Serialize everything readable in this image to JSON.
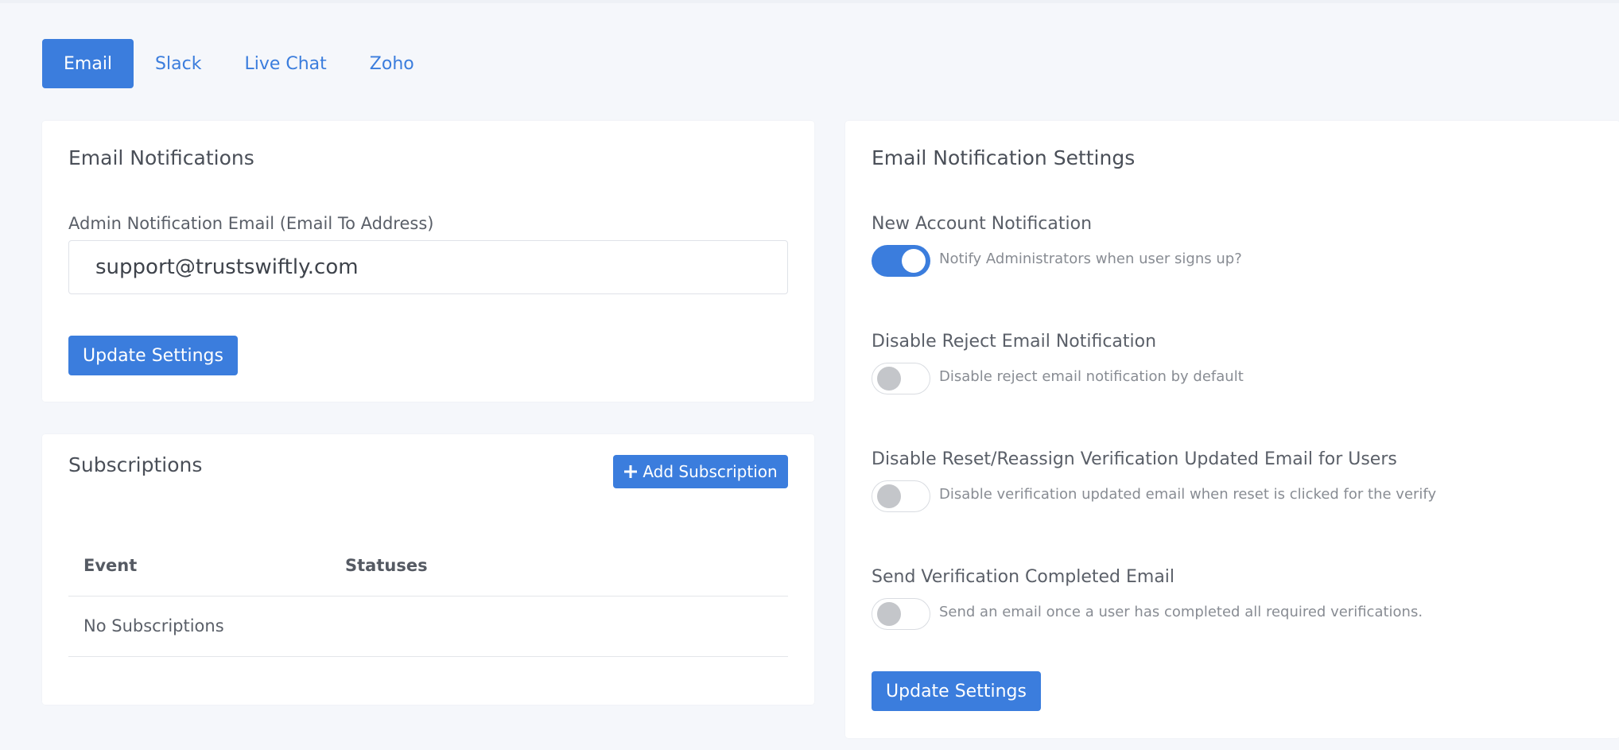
{
  "tabs": [
    {
      "label": "Email",
      "active": true
    },
    {
      "label": "Slack",
      "active": false
    },
    {
      "label": "Live Chat",
      "active": false
    },
    {
      "label": "Zoho",
      "active": false
    }
  ],
  "email_card": {
    "title": "Email Notifications",
    "field_label": "Admin Notification Email (Email To Address)",
    "field_value": "support@trustswiftly.com",
    "button": "Update Settings"
  },
  "subscriptions": {
    "title": "Subscriptions",
    "add_button": "Add Subscription",
    "columns": [
      "Event",
      "Statuses"
    ],
    "empty_text": "No Subscriptions"
  },
  "settings_card": {
    "title": "Email Notification Settings",
    "items": [
      {
        "title": "New Account Notification",
        "desc": "Notify Administrators when user signs up?",
        "enabled": true
      },
      {
        "title": "Disable Reject Email Notification",
        "desc": "Disable reject email notification by default",
        "enabled": false
      },
      {
        "title": "Disable Reset/Reassign Verification Updated Email for Users",
        "desc": "Disable verification updated email when reset is clicked for the verify",
        "enabled": false
      },
      {
        "title": "Send Verification Completed Email",
        "desc": "Send an email once a user has completed all required verifications.",
        "enabled": false
      }
    ],
    "button": "Update Settings"
  },
  "colors": {
    "accent": "#3b7ddd",
    "background": "#f5f7fb",
    "card": "#ffffff",
    "toggle_off_knob": "#c4c6ca"
  }
}
